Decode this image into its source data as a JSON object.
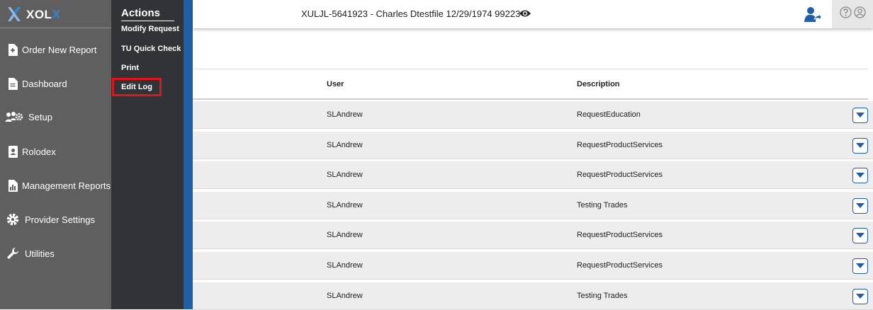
{
  "brand": {
    "name_main": "XOL",
    "name_accent": "X",
    "logo_icon": "xolx-logo-icon",
    "accent_color": "#2f84d8"
  },
  "sidebar": {
    "items": [
      {
        "label": "Order New Report",
        "icon": "document-plus-icon"
      },
      {
        "label": "Dashboard",
        "icon": "document-icon"
      },
      {
        "label": "Setup",
        "icon": "users-gear-icon"
      },
      {
        "label": "Rolodex",
        "icon": "address-book-icon"
      },
      {
        "label": "Management Reports",
        "icon": "report-chart-icon"
      },
      {
        "label": "Provider Settings",
        "icon": "gear-icon"
      },
      {
        "label": "Utilities",
        "icon": "wrench-icon"
      }
    ]
  },
  "actions": {
    "title": "Actions",
    "items": [
      {
        "label": "Modify Request"
      },
      {
        "label": "TU Quick Check"
      },
      {
        "label": "Print"
      },
      {
        "label": "Edit Log",
        "highlighted": true
      }
    ]
  },
  "header": {
    "record": "XULJL-5641923 - Charles Dtestfile 12/29/1974 99223",
    "icons": [
      "eye-icon",
      "user-share-icon",
      "help-icon",
      "profile-icon"
    ]
  },
  "table": {
    "columns": [
      "User",
      "Description"
    ],
    "rows": [
      {
        "user": "SLAndrew",
        "description": "RequestEducation"
      },
      {
        "user": "SLAndrew",
        "description": "RequestProductServices"
      },
      {
        "user": "SLAndrew",
        "description": "RequestProductServices"
      },
      {
        "user": "SLAndrew",
        "description": "Testing Trades"
      },
      {
        "user": "SLAndrew",
        "description": "RequestProductServices"
      },
      {
        "user": "SLAndrew",
        "description": "RequestProductServices"
      },
      {
        "user": "SLAndrew",
        "description": "Testing Trades"
      }
    ]
  },
  "colors": {
    "sidebar": "#5f5f5f",
    "actions_panel": "#323336",
    "brand_blue": "#1e5fa8",
    "highlight_red": "#e0141a"
  }
}
